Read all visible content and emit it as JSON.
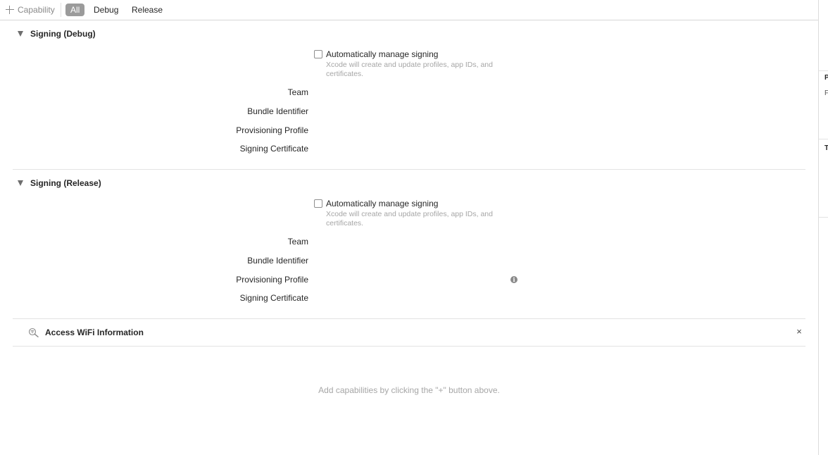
{
  "toolbar": {
    "add_capability_label": "Capability",
    "filters": [
      "All",
      "Debug",
      "Release"
    ],
    "active_filter": "All"
  },
  "signing_debug": {
    "title": "Signing (Debug)",
    "auto_manage_label": "Automatically manage signing",
    "auto_manage_checked": false,
    "auto_manage_help": "Xcode will create and update profiles, app IDs, and certificates.",
    "fields": [
      "Team",
      "Bundle Identifier",
      "Provisioning Profile",
      "Signing Certificate"
    ]
  },
  "signing_release": {
    "title": "Signing (Release)",
    "auto_manage_label": "Automatically manage signing",
    "auto_manage_checked": false,
    "auto_manage_help": "Xcode will create and update profiles, app IDs, and certificates.",
    "fields": [
      "Team",
      "Bundle Identifier",
      "Provisioning Profile",
      "Signing Certificate"
    ],
    "info_icon": "i"
  },
  "capability": {
    "title": "Access WiFi Information",
    "icon": "wifi-search-icon",
    "remove_glyph": "×"
  },
  "empty_hint": "Add capabilities by clicking the \"+\" button above.",
  "right_panel": {
    "letters": [
      "P",
      "F",
      "T"
    ]
  }
}
